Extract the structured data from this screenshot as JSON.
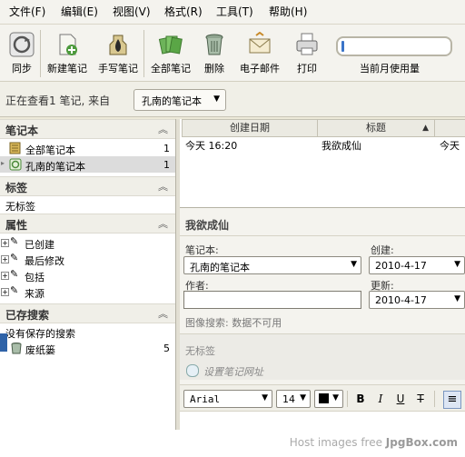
{
  "menu": [
    {
      "label": "文件(F)"
    },
    {
      "label": "编辑(E)"
    },
    {
      "label": "视图(V)"
    },
    {
      "label": "格式(R)"
    },
    {
      "label": "工具(T)"
    },
    {
      "label": "帮助(H)"
    }
  ],
  "toolbar": {
    "sync": "同步",
    "new_note": "新建笔记",
    "ink_note": "手写笔记",
    "all_notes": "全部笔记",
    "delete": "删除",
    "email": "电子邮件",
    "print": "打印",
    "usage_label": "当前月使用量",
    "usage_fraction": 0.02
  },
  "viewbar": {
    "text": "正在查看1 笔记, 来自",
    "notebook": "孔南的笔记本"
  },
  "sidebar": {
    "notebooks_header": "笔记本",
    "notebooks": [
      {
        "label": "全部笔记本",
        "count": "1"
      },
      {
        "label": "孔南的笔记本",
        "count": "1"
      }
    ],
    "tags_header": "标签",
    "no_tags": "无标签",
    "attributes_header": "属性",
    "attributes": [
      {
        "label": "已创建"
      },
      {
        "label": "最后修改"
      },
      {
        "label": "包括"
      },
      {
        "label": "来源"
      }
    ],
    "saved_header": "已存搜索",
    "no_saved": "没有保存的搜索",
    "trash": {
      "label": "废纸篓",
      "count": "5"
    }
  },
  "notelist": {
    "columns": [
      "创建日期",
      "标题"
    ],
    "rows": [
      {
        "date": "今天 16:20",
        "title": "我欲成仙",
        "extra": "今天"
      }
    ]
  },
  "editor": {
    "title": "我欲成仙",
    "notebook_label": "笔记本:",
    "notebook_value": "孔南的笔记本",
    "created_label": "创建:",
    "created_value": "2010-4-17",
    "author_label": "作者:",
    "author_value": "",
    "updated_label": "更新:",
    "updated_value": "2010-4-17",
    "image_search": "图像搜索: 数据不可用",
    "no_tags": "无标签",
    "url_placeholder": "设置笔记网址",
    "font": "Arial",
    "size": "14"
  },
  "watermark": {
    "prefix": "Host images free ",
    "site": "JpgBox.com"
  }
}
